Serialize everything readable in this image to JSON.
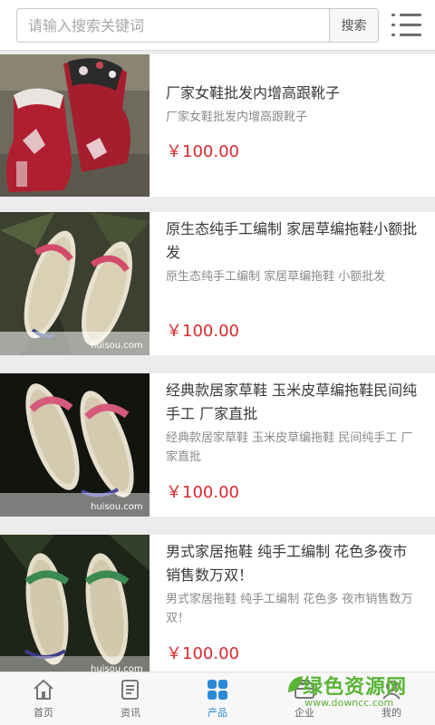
{
  "search": {
    "placeholder": "请输入搜索关键词",
    "button_label": "搜索"
  },
  "products": [
    {
      "title": "厂家女鞋批发内增高跟靴子",
      "subtitle": "厂家女鞋批发内增高跟靴子",
      "price": "￥100.00"
    },
    {
      "title": "原生态纯手工编制 家居草编拖鞋小额批发",
      "subtitle": "原生态纯手工编制 家居草编拖鞋 小额批发",
      "price": "￥100.00",
      "image_caption": "huisou.com"
    },
    {
      "title": "经典款居家草鞋 玉米皮草编拖鞋民间纯手工 厂家直批",
      "subtitle": "经典款居家草鞋 玉米皮草编拖鞋 民间纯手工 厂家直批",
      "price": "￥100.00",
      "image_caption": "huisou.com"
    },
    {
      "title": "男式家居拖鞋 纯手工编制 花色多夜市销售数万双！",
      "subtitle": "男式家居拖鞋 纯手工编制 花色多 夜市销售数万双！",
      "price": "￥100.00",
      "image_caption": "huisou.com"
    }
  ],
  "bottom_nav": [
    {
      "label": "首页",
      "icon": "home-icon"
    },
    {
      "label": "资讯",
      "icon": "news-icon"
    },
    {
      "label": "产品",
      "icon": "products-grid-icon",
      "active": true
    },
    {
      "label": "企业",
      "icon": "company-icon"
    },
    {
      "label": "我的",
      "icon": "user-icon"
    }
  ],
  "watermark": {
    "title": "绿色资源网",
    "url": "www.downcc.com"
  },
  "colors": {
    "price": "#d9282f",
    "active_nav": "#2a8ad8",
    "watermark": "#5ab436"
  }
}
